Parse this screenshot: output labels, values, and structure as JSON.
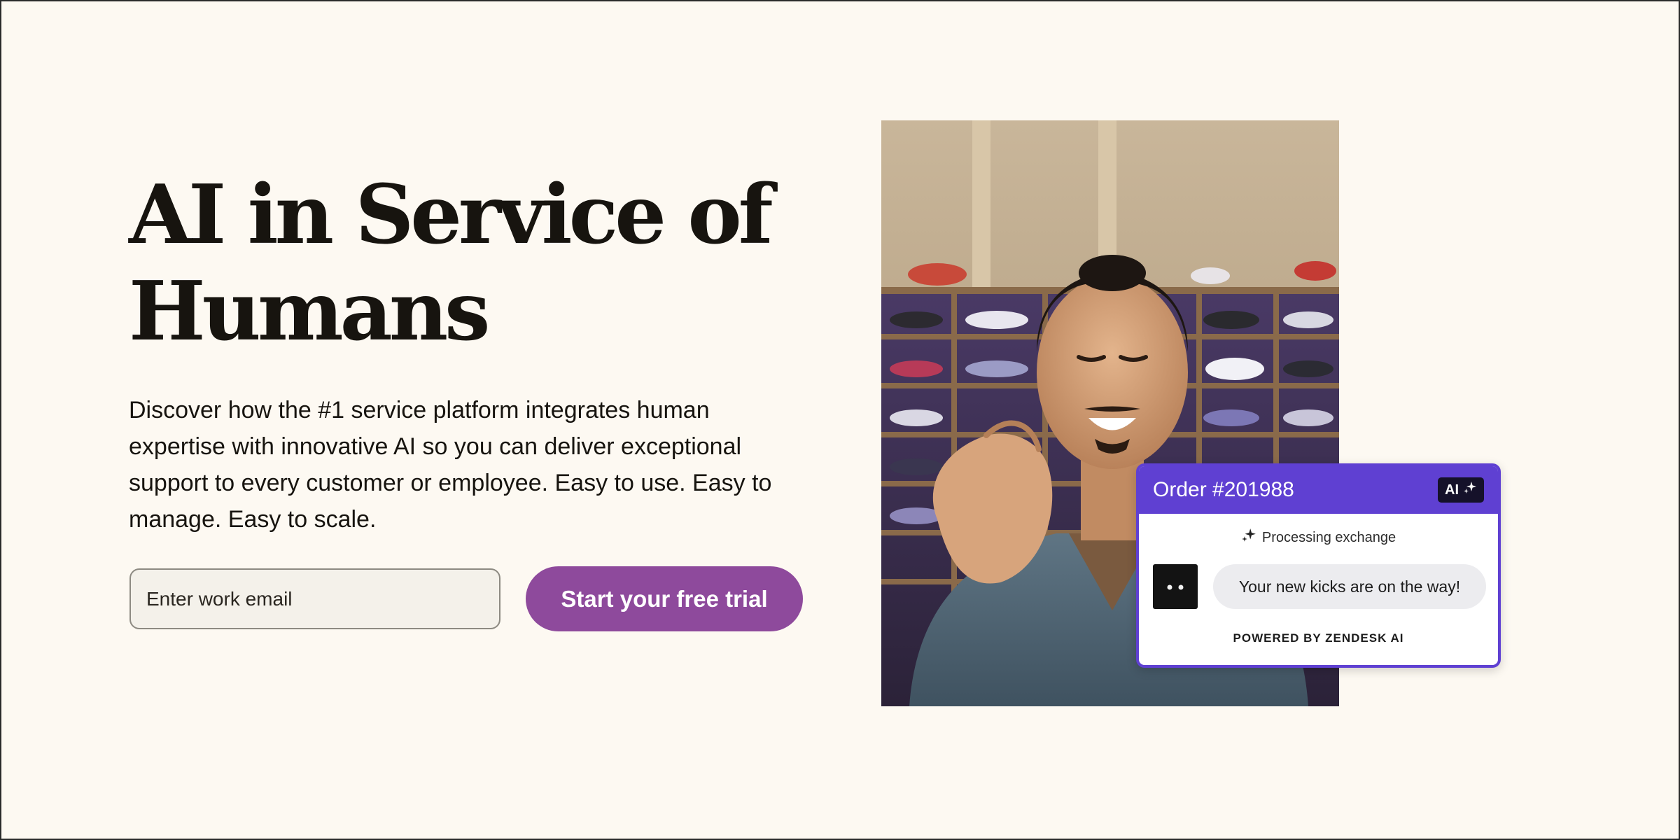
{
  "hero": {
    "title": "AI in Service of Humans",
    "description": "Discover how the #1 service platform integrates human expertise with innovative AI so you can deliver exceptional support to every customer or employee. Easy to use. Easy to manage. Easy to scale."
  },
  "signup": {
    "email_placeholder": "Enter work email",
    "email_value": "",
    "cta_label": "Start your free trial"
  },
  "photo": {
    "subject": "man-making-heart-gesture-in-shoe-store"
  },
  "order_card": {
    "title": "Order #201988",
    "badge_label": "AI",
    "badge_icon": "sparkle-icon",
    "status_icon": "sparkle-icon",
    "status_text": "Processing exchange",
    "message": "Your new kicks are on the way!",
    "powered_by": "POWERED BY ZENDESK AI"
  },
  "colors": {
    "background": "#fdf9f2",
    "cta": "#8e4a9c",
    "card_accent": "#5f40d2",
    "text": "#17140f"
  }
}
